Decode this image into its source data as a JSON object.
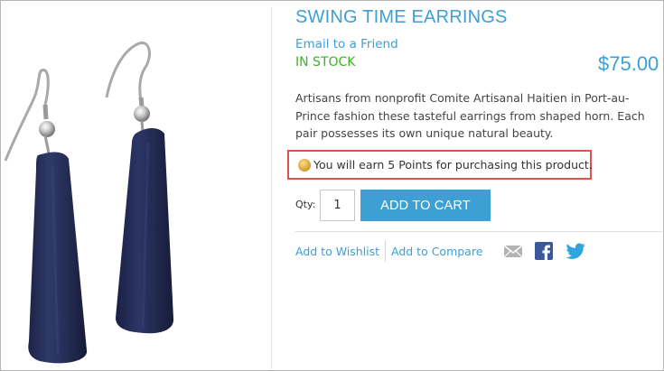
{
  "product": {
    "title": "SWING TIME EARRINGS",
    "email_link": "Email to a Friend",
    "stock_status": "IN STOCK",
    "price": "$75.00",
    "description": "Artisans from nonprofit Comite Artisanal Haitien in Port-au-Prince fashion these tasteful earrings from shaped horn. Each pair possesses its own unique natural beauty."
  },
  "points": {
    "icon": "coin-icon",
    "message": "You will earn 5 Points for purchasing this product."
  },
  "cart": {
    "qty_label": "Qty:",
    "qty_value": "1",
    "add_to_cart_label": "ADD TO CART"
  },
  "links": {
    "wishlist": "Add to Wishlist",
    "compare": "Add to Compare"
  },
  "share_icons": [
    "email-icon",
    "facebook-icon",
    "twitter-icon"
  ],
  "colors": {
    "accent": "#3d9fd4",
    "in_stock": "#3cb521",
    "highlight_border": "#d9534f",
    "earring": "#262f56"
  }
}
